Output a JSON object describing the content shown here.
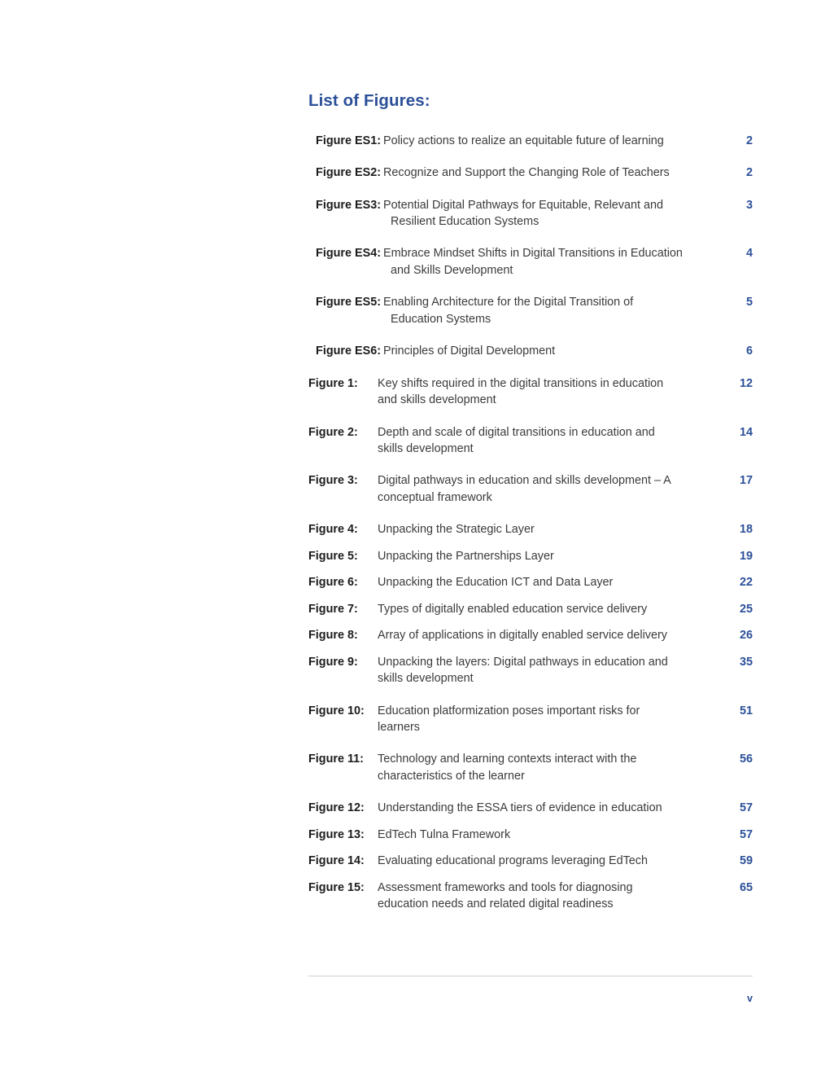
{
  "heading": "List of Figures:",
  "entries": [
    {
      "label": "Figure ES1:",
      "style": "es",
      "tight": false,
      "line1": "Policy actions to realize an equitable future of learning",
      "line2": "",
      "page": "2"
    },
    {
      "label": "Figure ES2:",
      "style": "es",
      "tight": false,
      "line1": "Recognize and Support the Changing Role of Teachers",
      "line2": "",
      "page": "2"
    },
    {
      "label": "Figure ES3:",
      "style": "es",
      "tight": false,
      "line1": "Potential Digital Pathways for Equitable, Relevant and",
      "line2": "Resilient Education Systems",
      "page": "3"
    },
    {
      "label": "Figure ES4:",
      "style": "es",
      "tight": false,
      "line1": "Embrace Mindset Shifts in Digital Transitions in Education",
      "line2": "and Skills Development",
      "page": "4"
    },
    {
      "label": "Figure ES5:",
      "style": "es",
      "tight": false,
      "line1": "Enabling Architecture for the Digital Transition of",
      "line2": "Education Systems",
      "page": "5"
    },
    {
      "label": "Figure ES6:",
      "style": "es",
      "tight": false,
      "line1": "Principles of Digital Development",
      "line2": "",
      "page": "6"
    },
    {
      "label": "Figure 1:",
      "style": "num",
      "tight": false,
      "line1": "Key shifts required in the digital transitions in education",
      "line2": "and skills development",
      "page": "12"
    },
    {
      "label": "Figure 2:",
      "style": "num",
      "tight": false,
      "line1": "Depth and scale of digital transitions in education and",
      "line2": "skills development",
      "page": "14"
    },
    {
      "label": "Figure 3:",
      "style": "num",
      "tight": false,
      "line1": "Digital pathways in education and skills development – A",
      "line2": "conceptual framework",
      "page": "17"
    },
    {
      "label": "Figure 4:",
      "style": "num",
      "tight": true,
      "line1": "Unpacking the Strategic Layer",
      "line2": "",
      "page": "18"
    },
    {
      "label": "Figure 5:",
      "style": "num",
      "tight": true,
      "line1": "Unpacking the Partnerships Layer",
      "line2": "",
      "page": "19"
    },
    {
      "label": "Figure 6:",
      "style": "num",
      "tight": true,
      "line1": "Unpacking the Education ICT and Data Layer",
      "line2": "",
      "page": "22"
    },
    {
      "label": "Figure 7:",
      "style": "num",
      "tight": true,
      "line1": "Types of digitally enabled education service delivery",
      "line2": "",
      "page": "25"
    },
    {
      "label": "Figure 8:",
      "style": "num",
      "tight": true,
      "line1": "Array of applications in digitally enabled service delivery",
      "line2": "",
      "page": "26"
    },
    {
      "label": "Figure 9:",
      "style": "num",
      "tight": false,
      "line1": "Unpacking the layers: Digital pathways in education and",
      "line2": "skills development",
      "page": "35"
    },
    {
      "label": "Figure 10:",
      "style": "num",
      "tight": false,
      "line1": "Education platformization poses important risks for",
      "line2": "learners",
      "page": "51"
    },
    {
      "label": "Figure 11:",
      "style": "num",
      "tight": false,
      "line1": "Technology and learning contexts interact with the",
      "line2": "characteristics of the learner",
      "page": "56"
    },
    {
      "label": "Figure 12:",
      "style": "num",
      "tight": true,
      "line1": "Understanding the ESSA tiers of evidence in education",
      "line2": "",
      "page": "57"
    },
    {
      "label": "Figure 13:",
      "style": "num",
      "tight": true,
      "line1": "EdTech Tulna Framework",
      "line2": "",
      "page": "57"
    },
    {
      "label": "Figure 14:",
      "style": "num",
      "tight": true,
      "line1": "Evaluating educational programs leveraging EdTech",
      "line2": "",
      "page": "59"
    },
    {
      "label": "Figure 15:",
      "style": "num",
      "tight": false,
      "line1": "Assessment frameworks and tools for diagnosing",
      "line2": "education needs and related digital readiness",
      "page": "65"
    }
  ],
  "footer": {
    "page_number": "v"
  },
  "colors": {
    "accent_blue": "#2b5099",
    "body_text": "#3b3b3b",
    "label_text": "#1c1c1c",
    "rule": "#cfcfcf"
  }
}
